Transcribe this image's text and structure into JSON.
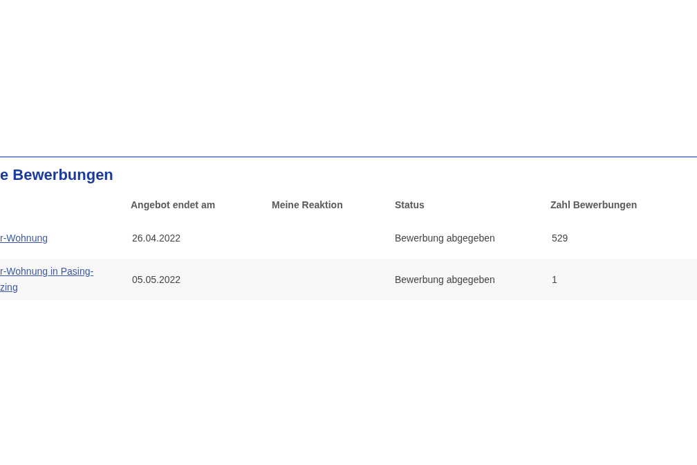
{
  "section": {
    "title": "e Bewerbungen"
  },
  "table": {
    "columns": [
      "Angebot endet am",
      "Meine Reaktion",
      "Status",
      "Zahl Bewerbungen"
    ],
    "rows": [
      {
        "offer": [
          "r-Wohnung"
        ],
        "ends": "26.04.2022",
        "status": "Bewerbung abgegeben",
        "count": "529"
      },
      {
        "offer": [
          "r-Wohnung in Pasing-",
          "zing"
        ],
        "ends": "05.05.2022",
        "status": "Bewerbung abgegeben",
        "count": "1"
      }
    ]
  }
}
